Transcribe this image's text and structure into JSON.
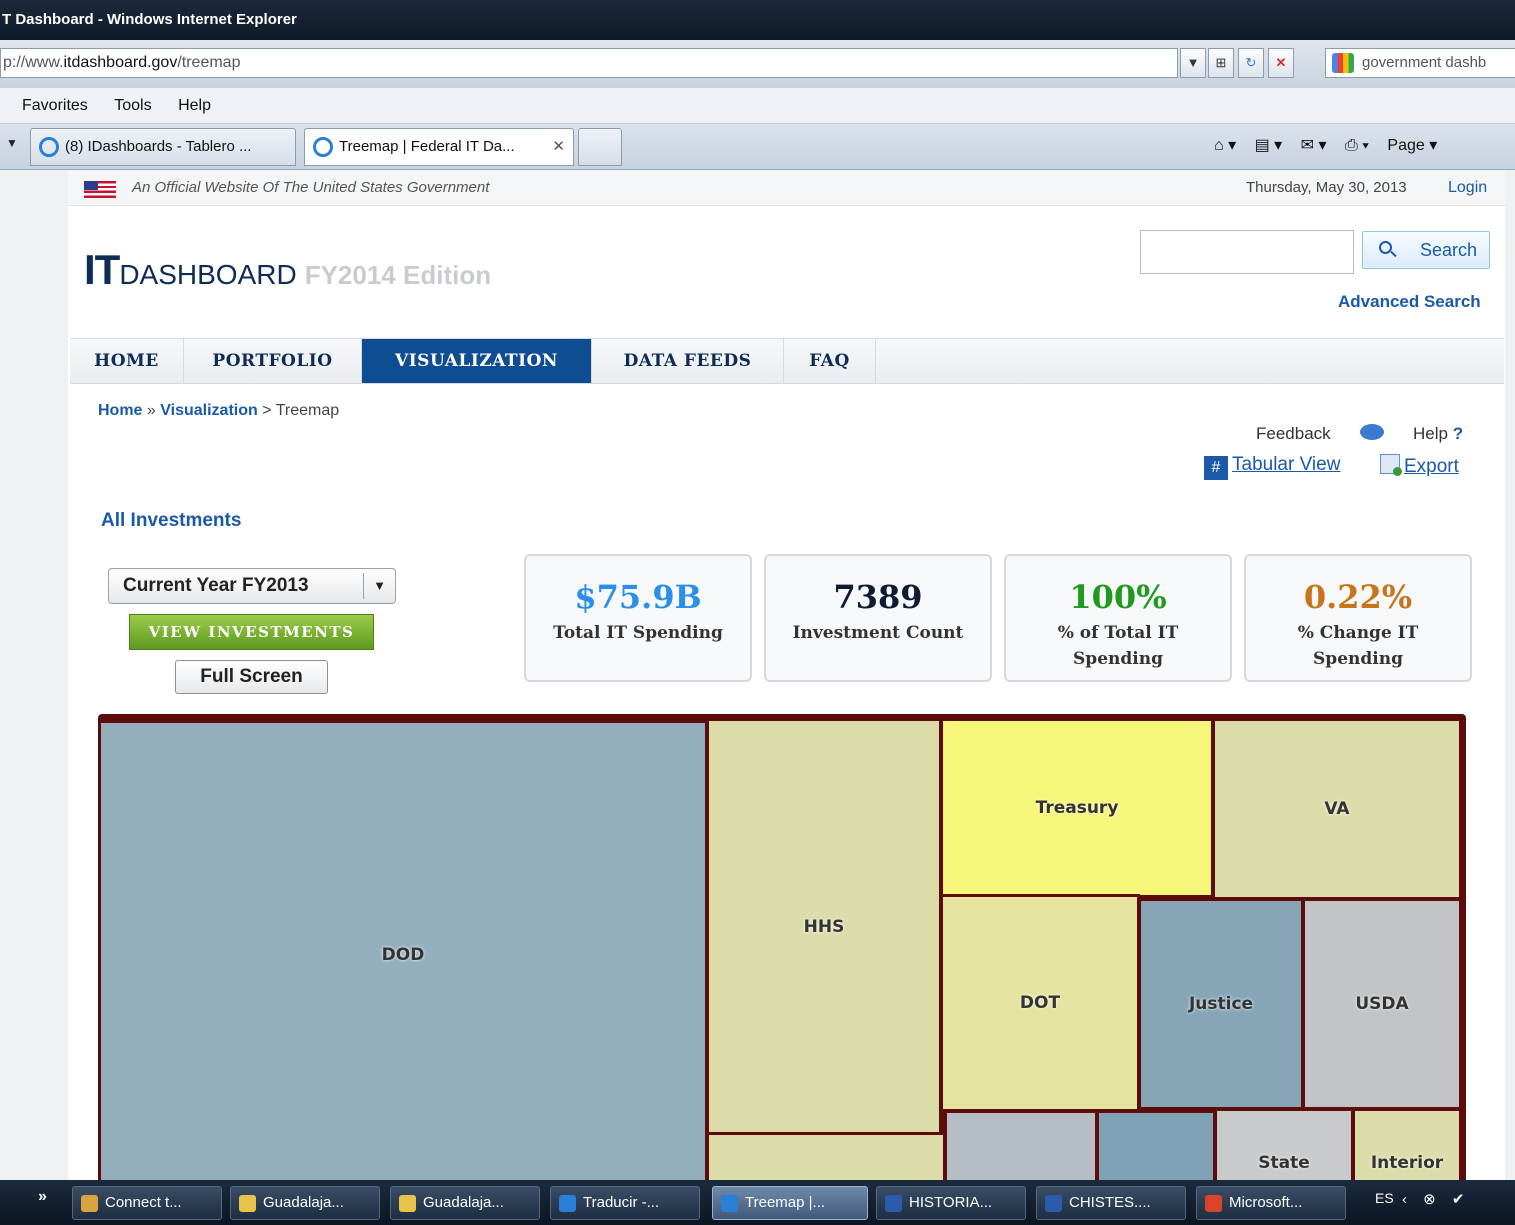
{
  "browser": {
    "title": "T Dashboard - Windows Internet Explorer",
    "url_prefix": "p://www.",
    "url_domain": "itdashboard.gov",
    "url_path": "/treemap",
    "search_text": "government dashb",
    "menu": [
      "Favorites",
      "Tools",
      "Help"
    ],
    "tabs": [
      {
        "label": "(8) IDashboards - Tablero ..."
      },
      {
        "label": "Treemap | Federal IT Da..."
      }
    ],
    "tab_close": "✕",
    "command_bar": {
      "home": "⌂ ▾",
      "feeds": "▤ ▾",
      "mail": "✉ ▾",
      "print": "⎙ ▾",
      "page": "Page ▾"
    }
  },
  "site": {
    "official_text": "An Official Website Of The United States Government",
    "date": "Thursday, May 30, 2013",
    "login": "Login",
    "logo": {
      "it": "IT",
      "dashboard": "DASHBOARD",
      "edition": "FY2014 Edition"
    },
    "search_button": "Search",
    "search_value": "",
    "advanced_search": "Advanced Search",
    "nav": [
      "HOME",
      "PORTFOLIO",
      "VISUALIZATION",
      "DATA FEEDS",
      "FAQ"
    ],
    "nav_active": "VISUALIZATION",
    "breadcrumb": {
      "home": "Home",
      "sep1": " » ",
      "viz": "Visualization",
      "sep2": " > ",
      "current": "Treemap"
    },
    "feedback": "Feedback",
    "help": "Help",
    "help_q": "?",
    "tabular_view": "Tabular View",
    "export": "Export",
    "all_investments": "All Investments",
    "year_select": "Current Year FY2013",
    "view_investments": "VIEW INVESTMENTS",
    "full_screen": "Full Screen",
    "stats": [
      {
        "value": "$75.9B",
        "label": "Total IT Spending",
        "color": "#2b8ee8"
      },
      {
        "value": "7389",
        "label": "Investment Count",
        "color": "#0d1b33"
      },
      {
        "value": "100%",
        "label": "% of Total IT Spending",
        "color": "#1f9a1f"
      },
      {
        "value": "0.22%",
        "label": "% Change IT Spending",
        "color": "#c8741a"
      }
    ],
    "treemap": [
      {
        "label": "DOD",
        "color": "#93afbd"
      },
      {
        "label": "HHS",
        "color": "#dcdcaa"
      },
      {
        "label": "Treasury",
        "color": "#f6f67a"
      },
      {
        "label": "VA",
        "color": "#dcdcaa"
      },
      {
        "label": "DOT",
        "color": "#e4e4a0"
      },
      {
        "label": "Justice",
        "color": "#86a6b7"
      },
      {
        "label": "USDA",
        "color": "#c0c4c6"
      },
      {
        "label": "",
        "color": "#dcdcaa"
      },
      {
        "label": "",
        "color": "#b4bec4"
      },
      {
        "label": "",
        "color": "#7fa2b6"
      },
      {
        "label": "State",
        "color": "#c8cacb"
      },
      {
        "label": "Interior",
        "color": "#dcdcaa"
      }
    ]
  },
  "taskbar": {
    "chevron": "»",
    "items": [
      {
        "label": "Connect t...",
        "color": "#d9a441"
      },
      {
        "label": "Guadalaja...",
        "color": "#e8c24a"
      },
      {
        "label": "Guadalaja...",
        "color": "#e8c24a"
      },
      {
        "label": "Traducir -...",
        "color": "#2a7fd6"
      },
      {
        "label": "Treemap |...",
        "color": "#2a7fd6"
      },
      {
        "label": "HISTORIA...",
        "color": "#2b5caa"
      },
      {
        "label": "CHISTES....",
        "color": "#2b5caa"
      },
      {
        "label": "Microsoft...",
        "color": "#d9442b"
      }
    ],
    "lang": "ES",
    "tray": "‹ ⊗ ✔"
  }
}
